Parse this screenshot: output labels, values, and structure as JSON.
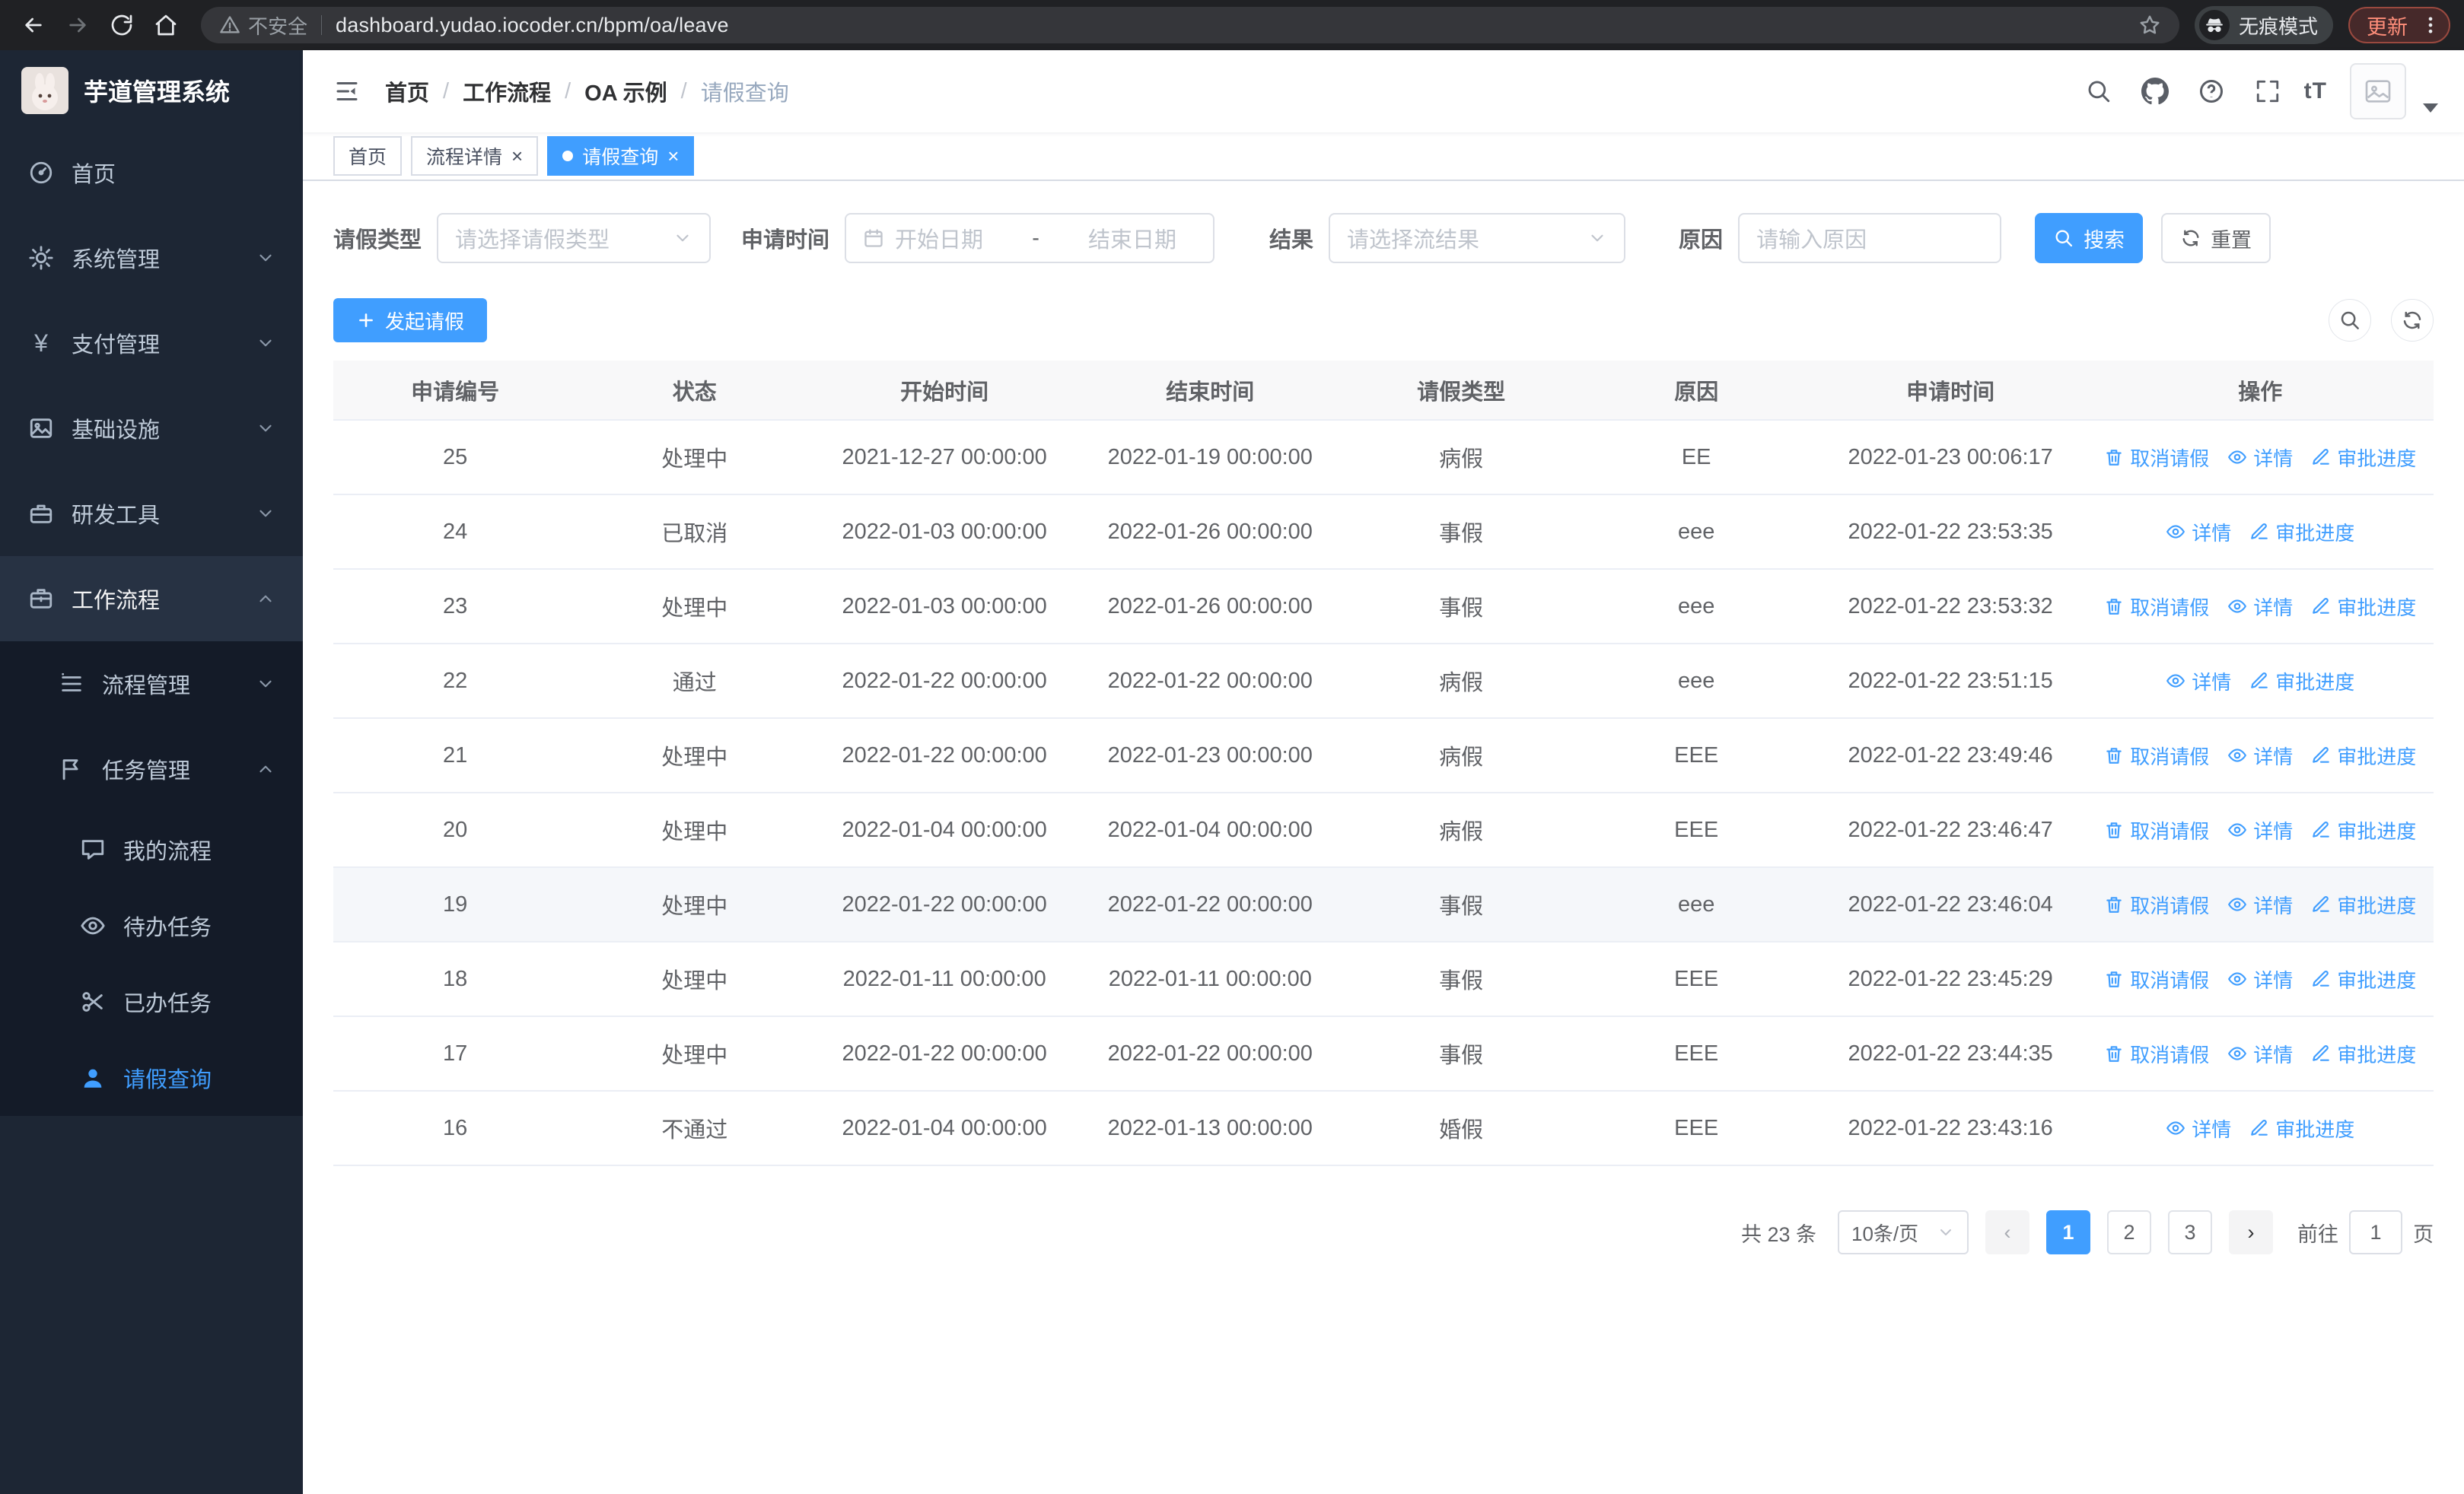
{
  "browser": {
    "security_label": "不安全",
    "url": "dashboard.yudao.iocoder.cn/bpm/oa/leave",
    "incognito_label": "无痕模式",
    "update_label": "更新"
  },
  "sidebar": {
    "app_title": "芋道管理系统",
    "items": [
      {
        "label": "首页",
        "level": 1
      },
      {
        "label": "系统管理",
        "level": 1,
        "state": "collapsed"
      },
      {
        "label": "支付管理",
        "level": 1,
        "state": "collapsed"
      },
      {
        "label": "基础设施",
        "level": 1,
        "state": "collapsed"
      },
      {
        "label": "研发工具",
        "level": 1,
        "state": "collapsed"
      },
      {
        "label": "工作流程",
        "level": 1,
        "state": "expanded"
      },
      {
        "label": "流程管理",
        "level": 2,
        "state": "collapsed"
      },
      {
        "label": "任务管理",
        "level": 2,
        "state": "expanded"
      },
      {
        "label": "我的流程",
        "level": 3
      },
      {
        "label": "待办任务",
        "level": 3
      },
      {
        "label": "已办任务",
        "level": 3
      },
      {
        "label": "请假查询",
        "level": 3,
        "active": true
      }
    ]
  },
  "header": {
    "breadcrumb": [
      "首页",
      "工作流程",
      "OA 示例",
      "请假查询"
    ],
    "separator": "/",
    "text_size_icon_label": "tT"
  },
  "tabs": [
    {
      "label": "首页",
      "closable": false,
      "active": false
    },
    {
      "label": "流程详情",
      "closable": true,
      "active": false
    },
    {
      "label": "请假查询",
      "closable": true,
      "active": true
    }
  ],
  "tab_close_glyph": "×",
  "filters": {
    "leave_type_label": "请假类型",
    "leave_type_placeholder": "请选择请假类型",
    "apply_time_label": "申请时间",
    "start_date_placeholder": "开始日期",
    "date_separator": "-",
    "end_date_placeholder": "结束日期",
    "result_label": "结果",
    "result_placeholder": "请选择流结果",
    "reason_label": "原因",
    "reason_placeholder": "请输入原因",
    "search_label": "搜索",
    "reset_label": "重置"
  },
  "toolbar": {
    "create_label": "发起请假"
  },
  "table": {
    "columns": [
      "申请编号",
      "状态",
      "开始时间",
      "结束时间",
      "请假类型",
      "原因",
      "申请时间",
      "操作"
    ],
    "action_labels": {
      "cancel": "取消请假",
      "detail": "详情",
      "progress": "审批进度"
    },
    "rows": [
      {
        "id": "25",
        "status": "处理中",
        "start": "2021-12-27 00:00:00",
        "end": "2022-01-19 00:00:00",
        "type": "病假",
        "reason": "EE",
        "applied": "2022-01-23 00:06:17",
        "actions": [
          "cancel",
          "detail",
          "progress"
        ]
      },
      {
        "id": "24",
        "status": "已取消",
        "start": "2022-01-03 00:00:00",
        "end": "2022-01-26 00:00:00",
        "type": "事假",
        "reason": "eee",
        "applied": "2022-01-22 23:53:35",
        "actions": [
          "detail",
          "progress"
        ]
      },
      {
        "id": "23",
        "status": "处理中",
        "start": "2022-01-03 00:00:00",
        "end": "2022-01-26 00:00:00",
        "type": "事假",
        "reason": "eee",
        "applied": "2022-01-22 23:53:32",
        "actions": [
          "cancel",
          "detail",
          "progress"
        ]
      },
      {
        "id": "22",
        "status": "通过",
        "start": "2022-01-22 00:00:00",
        "end": "2022-01-22 00:00:00",
        "type": "病假",
        "reason": "eee",
        "applied": "2022-01-22 23:51:15",
        "actions": [
          "detail",
          "progress"
        ]
      },
      {
        "id": "21",
        "status": "处理中",
        "start": "2022-01-22 00:00:00",
        "end": "2022-01-23 00:00:00",
        "type": "病假",
        "reason": "EEE",
        "applied": "2022-01-22 23:49:46",
        "actions": [
          "cancel",
          "detail",
          "progress"
        ]
      },
      {
        "id": "20",
        "status": "处理中",
        "start": "2022-01-04 00:00:00",
        "end": "2022-01-04 00:00:00",
        "type": "病假",
        "reason": "EEE",
        "applied": "2022-01-22 23:46:47",
        "actions": [
          "cancel",
          "detail",
          "progress"
        ]
      },
      {
        "id": "19",
        "status": "处理中",
        "start": "2022-01-22 00:00:00",
        "end": "2022-01-22 00:00:00",
        "type": "事假",
        "reason": "eee",
        "applied": "2022-01-22 23:46:04",
        "actions": [
          "cancel",
          "detail",
          "progress"
        ],
        "highlighted": true
      },
      {
        "id": "18",
        "status": "处理中",
        "start": "2022-01-11 00:00:00",
        "end": "2022-01-11 00:00:00",
        "type": "事假",
        "reason": "EEE",
        "applied": "2022-01-22 23:45:29",
        "actions": [
          "cancel",
          "detail",
          "progress"
        ]
      },
      {
        "id": "17",
        "status": "处理中",
        "start": "2022-01-22 00:00:00",
        "end": "2022-01-22 00:00:00",
        "type": "事假",
        "reason": "EEE",
        "applied": "2022-01-22 23:44:35",
        "actions": [
          "cancel",
          "detail",
          "progress"
        ]
      },
      {
        "id": "16",
        "status": "不通过",
        "start": "2022-01-04 00:00:00",
        "end": "2022-01-13 00:00:00",
        "type": "婚假",
        "reason": "EEE",
        "applied": "2022-01-22 23:43:16",
        "actions": [
          "detail",
          "progress"
        ]
      }
    ]
  },
  "pagination": {
    "total_label": "共 23 条",
    "page_size_label": "10条/页",
    "pages": [
      "1",
      "2",
      "3"
    ],
    "active_page": "1",
    "prev_glyph": "‹",
    "next_glyph": "›",
    "jump_prefix": "前往",
    "jump_value": "1",
    "jump_suffix": "页"
  },
  "colors": {
    "primary": "#409eff",
    "sidebar_bg": "#1d2634",
    "submenu_bg": "#141b28"
  }
}
